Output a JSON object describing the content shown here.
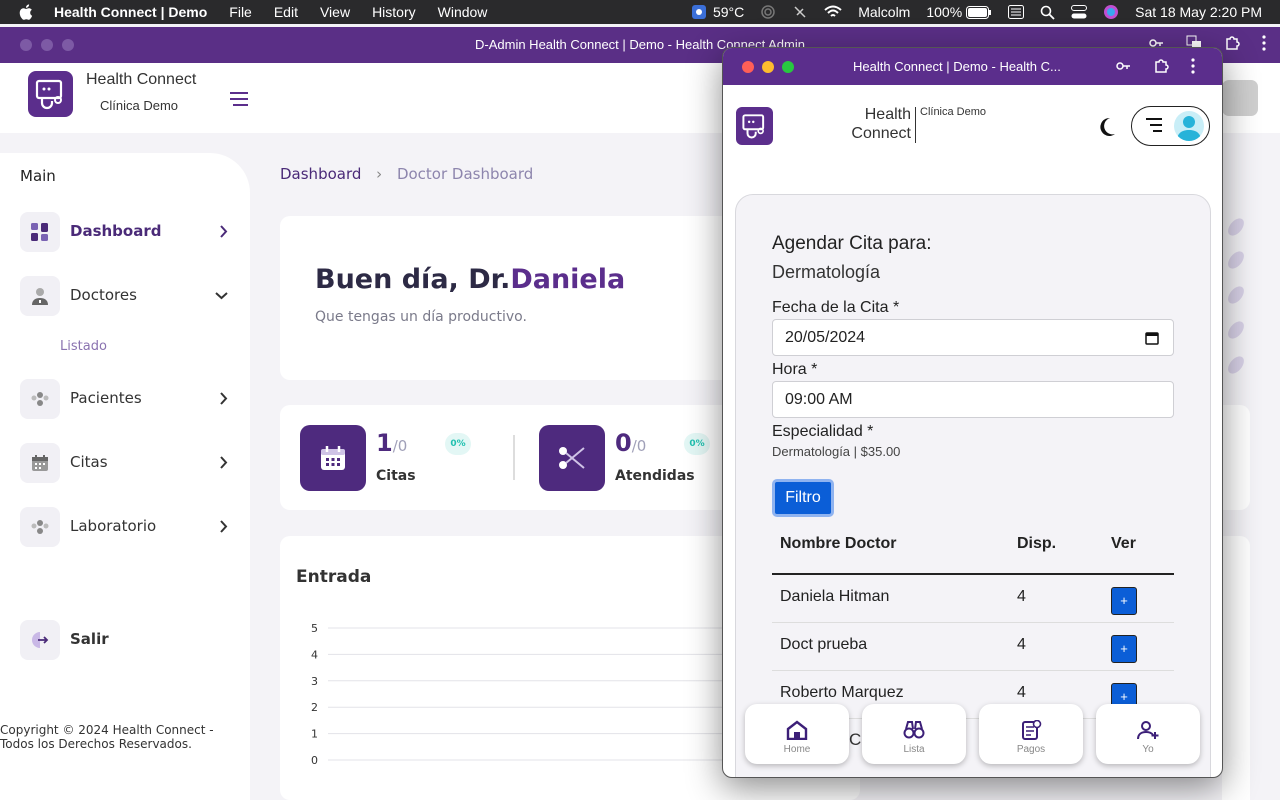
{
  "menubar": {
    "app_name": "Health Connect | Demo",
    "menus": [
      "File",
      "Edit",
      "View",
      "History",
      "Window"
    ],
    "weather": "59°C",
    "user": "Malcolm",
    "battery": "100%",
    "datetime": "Sat 18 May  2:20 PM"
  },
  "back_window": {
    "title": "D-Admin Health Connect | Demo - Health Connect Admin",
    "brand_name": "Health Connect",
    "brand_sub": "Clínica Demo",
    "sidebar": {
      "section": "Main",
      "items": [
        {
          "label": "Dashboard",
          "icon": "dashboard-grid-icon"
        },
        {
          "label": "Doctores",
          "icon": "doctor-icon"
        },
        {
          "label": "Pacientes",
          "icon": "patients-icon"
        },
        {
          "label": "Citas",
          "icon": "calendar-icon"
        },
        {
          "label": "Laboratorio",
          "icon": "laboratory-icon"
        }
      ],
      "sub_item": "Listado",
      "logout": "Salir",
      "copyright": "Copyright © 2024 Health Connect - Todos los Derechos Reservados."
    },
    "breadcrumb": {
      "root": "Dashboard",
      "current": "Doctor Dashboard"
    },
    "welcome": {
      "greeting": "Buen día, Dr.",
      "name": "Daniela",
      "subtitle": "Que tengas un día productivo."
    },
    "stats": [
      {
        "value": "1",
        "of": "/0",
        "label": "Citas",
        "pct": "0%"
      },
      {
        "value": "0",
        "of": "/0",
        "label": "Atendidas",
        "pct": "0%"
      }
    ],
    "chart_title": "Entrada",
    "chart_data": {
      "type": "line",
      "title": "Entrada",
      "y_ticks": [
        "5",
        "4",
        "3",
        "2",
        "1",
        "0"
      ],
      "ylim": [
        0,
        5
      ],
      "grid": true
    }
  },
  "popup": {
    "title": "Health Connect | Demo - Health C...",
    "brand_line1": "Health",
    "brand_line2": "Connect",
    "brand_sub": "Clínica Demo",
    "form": {
      "title": "Agendar Cita para:",
      "subtitle": "Dermatología",
      "date_label": "Fecha de la Cita *",
      "date_value": "20/05/2024",
      "time_label": "Hora *",
      "time_value": "09:00 AM",
      "specialty_label": "Especialidad *",
      "specialty_note": "Dermatología | $35.00",
      "filter_button": "Filtro"
    },
    "table": {
      "headers": [
        "Nombre Doctor",
        "Disp.",
        "Ver"
      ],
      "rows": [
        {
          "name": "Daniela Hitman",
          "disp": "4",
          "ver": "+"
        },
        {
          "name": "Doct prueba",
          "disp": "4",
          "ver": "+"
        },
        {
          "name": "Roberto Marquez",
          "disp": "4",
          "ver": "+"
        }
      ],
      "peek_text": "Co"
    },
    "bottom_nav": [
      {
        "label": "Home",
        "icon": "home-icon"
      },
      {
        "label": "Lista",
        "icon": "binoculars-icon"
      },
      {
        "label": "Pagos",
        "icon": "payments-icon"
      },
      {
        "label": "Yo",
        "icon": "add-user-icon"
      }
    ]
  },
  "colors": {
    "brand_purple": "#5b2e8c",
    "primary_blue": "#0b5ed7",
    "accent_teal": "#21c1b0"
  }
}
